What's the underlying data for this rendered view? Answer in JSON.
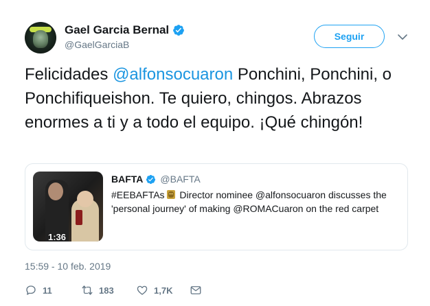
{
  "author": {
    "name": "Gael Garcia Bernal",
    "handle": "@GaelGarciaB"
  },
  "follow_label": "Seguir",
  "tweet": {
    "prefix": "Felicidades ",
    "mention": "@alfonsocuaron",
    "suffix": " Ponchini, Ponchini, o Ponchifiqueishon. Te quiero, chingos. Abrazos enormes a ti y a todo el equipo. ¡Qué chingón!"
  },
  "quoted": {
    "name": "BAFTA",
    "handle": "@BAFTA",
    "text_a": "#EEBAFTAs",
    "text_b": " Director nominee @alfonsocuaron discusses the 'personal journey' of making @ROMACuaron on the red carpet",
    "video_duration": "1:36"
  },
  "timestamp": "15:59 - 10 feb. 2019",
  "actions": {
    "replies": "11",
    "retweets": "183",
    "likes": "1,7K"
  },
  "icons": [
    "verified-icon",
    "chevron-down-icon",
    "bafta-mask-icon",
    "reply-icon",
    "retweet-icon",
    "like-icon",
    "message-icon"
  ],
  "colors": {
    "accent": "#1da1f2",
    "link": "#1b95e0",
    "muted": "#657786",
    "border": "#e1e8ed"
  }
}
